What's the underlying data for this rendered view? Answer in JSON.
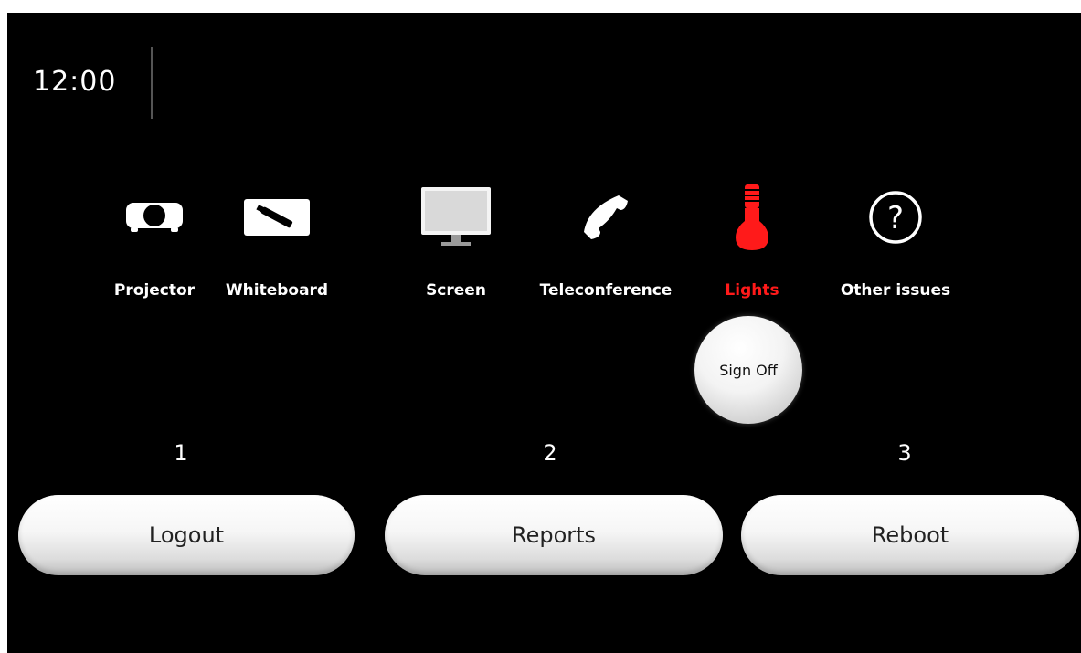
{
  "clock": {
    "time": "12:00"
  },
  "categories": [
    {
      "label": "Projector",
      "icon": "projector-icon"
    },
    {
      "label": "Whiteboard",
      "icon": "whiteboard-marker-icon"
    },
    {
      "label": "Screen",
      "icon": "monitor-icon"
    },
    {
      "label": "Teleconference",
      "icon": "phone-icon"
    },
    {
      "label": "Lights",
      "icon": "light-bulb-icon",
      "selected": true
    },
    {
      "label": "Other issues",
      "icon": "question-mark-icon"
    }
  ],
  "sign_off": {
    "label": "Sign Off"
  },
  "actions": [
    {
      "number": "1",
      "label": "Logout"
    },
    {
      "number": "2",
      "label": "Reports"
    },
    {
      "number": "3",
      "label": "Reboot"
    }
  ],
  "colors": {
    "background": "#000000",
    "text": "#ffffff",
    "selected": "#ff1a1a",
    "button": "#f2f2f2"
  }
}
